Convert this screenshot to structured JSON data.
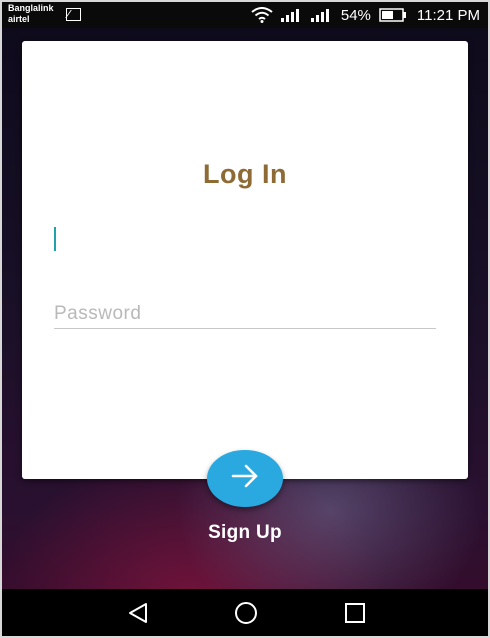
{
  "status_bar": {
    "carrier_line1": "Banglalink",
    "carrier_line2": "airtel",
    "battery_percent": "54%",
    "time": "11:21 PM",
    "icons": [
      "gallery-icon",
      "wifi-icon",
      "signal-icon",
      "signal-icon",
      "battery-icon"
    ]
  },
  "login": {
    "title": "Log In",
    "username_value": "",
    "password_placeholder": "Password"
  },
  "actions": {
    "submit_icon": "arrow-right-icon",
    "signup_label": "Sign Up"
  },
  "nav_bar": {
    "icons": [
      "back-icon",
      "home-icon",
      "recents-icon"
    ]
  },
  "colors": {
    "title": "#8e6a35",
    "fab": "#2aa8e0",
    "cursor": "#1fa3a8"
  }
}
